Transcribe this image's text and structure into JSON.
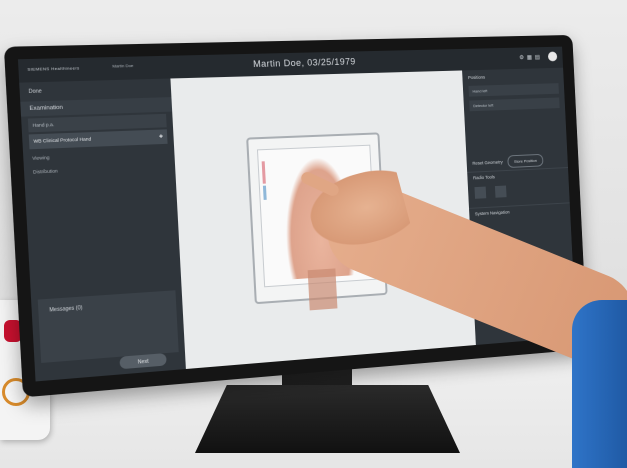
{
  "app": {
    "title": "Martin Doe, 03/25/1979",
    "logo_text": "SIEMENS Healthineers",
    "patient_tab": "Martin Doe"
  },
  "sidebar": {
    "header": "Done",
    "section": "Examination",
    "items": [
      {
        "label": "Hand p.a."
      },
      {
        "label": "WB Clinical Protocol Hand"
      }
    ],
    "links": [
      "Viewing",
      "Distribution"
    ],
    "messages_label": "Messages (0)",
    "next_button": "Next"
  },
  "rightpanel": {
    "header": "Positions",
    "rows": [
      "Hand left",
      "Detector left"
    ],
    "reset_label": "Reset Geometry",
    "store_button": "Store Position",
    "radio_tools": "Radio Tools",
    "system_navigation": "System Navigation"
  },
  "colors": {
    "screen_bg": "#2b3036",
    "canvas_bg": "#e9ebec",
    "accent_red": "#c8102e",
    "accent_orange": "#d98b2b"
  }
}
